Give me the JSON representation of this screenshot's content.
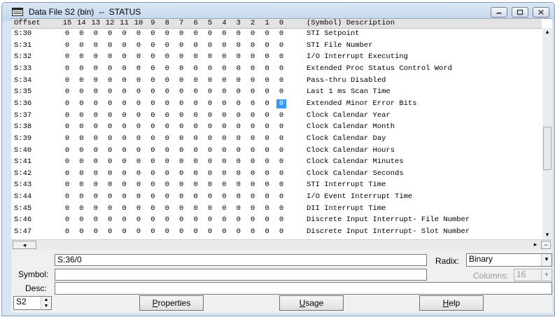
{
  "window": {
    "title": "Data File S2 (bin)  --  STATUS"
  },
  "grid": {
    "headers": {
      "offset": "Offset",
      "bits": [
        "15",
        "14",
        "13",
        "12",
        "11",
        "10",
        "9",
        "8",
        "7",
        "6",
        "5",
        "4",
        "3",
        "2",
        "1",
        "0"
      ],
      "description": "(Symbol) Description"
    },
    "rows": [
      {
        "offset": "S:30",
        "description": "STI Setpoint"
      },
      {
        "offset": "S:31",
        "description": "STI File Number"
      },
      {
        "offset": "S:32",
        "description": "I/O Interrupt Executing"
      },
      {
        "offset": "S:33",
        "description": "Extended Proc Status Control Word"
      },
      {
        "offset": "S:34",
        "description": "Pass-thru Disabled"
      },
      {
        "offset": "S:35",
        "description": "Last 1 ms Scan Time"
      },
      {
        "offset": "S:36",
        "description": "Extended Minor Error Bits"
      },
      {
        "offset": "S:37",
        "description": "Clock Calendar Year"
      },
      {
        "offset": "S:38",
        "description": "Clock Calendar Month"
      },
      {
        "offset": "S:39",
        "description": "Clock Calendar Day"
      },
      {
        "offset": "S:40",
        "description": "Clock Calendar Hours"
      },
      {
        "offset": "S:41",
        "description": "Clock Calendar Minutes"
      },
      {
        "offset": "S:42",
        "description": "Clock Calendar Seconds"
      },
      {
        "offset": "S:43",
        "description": "STI Interrupt Time"
      },
      {
        "offset": "S:44",
        "description": "I/O Event Interrupt Time"
      },
      {
        "offset": "S:45",
        "description": "DII Interrupt Time"
      },
      {
        "offset": "S:46",
        "description": "Discrete Input Interrupt- File Number"
      },
      {
        "offset": "S:47",
        "description": "Discrete Input Interrupt- Slot Number"
      }
    ],
    "bit_value": "0",
    "selected": {
      "row": "S:36",
      "bit": "0"
    }
  },
  "address_field": {
    "value": "S:36/0"
  },
  "symbol": {
    "label": "Symbol:",
    "value": ""
  },
  "desc": {
    "label": "Desc:",
    "value": ""
  },
  "radix": {
    "label": "Radix:",
    "value": "Binary"
  },
  "columns": {
    "label": "Columns:",
    "value": "16"
  },
  "file_selector": {
    "value": "S2"
  },
  "buttons": {
    "properties": "Properties",
    "usage": "Usage",
    "help": "Help"
  },
  "colors": {
    "selection": "#3399ff",
    "title_bar": "#c4d6ec"
  }
}
